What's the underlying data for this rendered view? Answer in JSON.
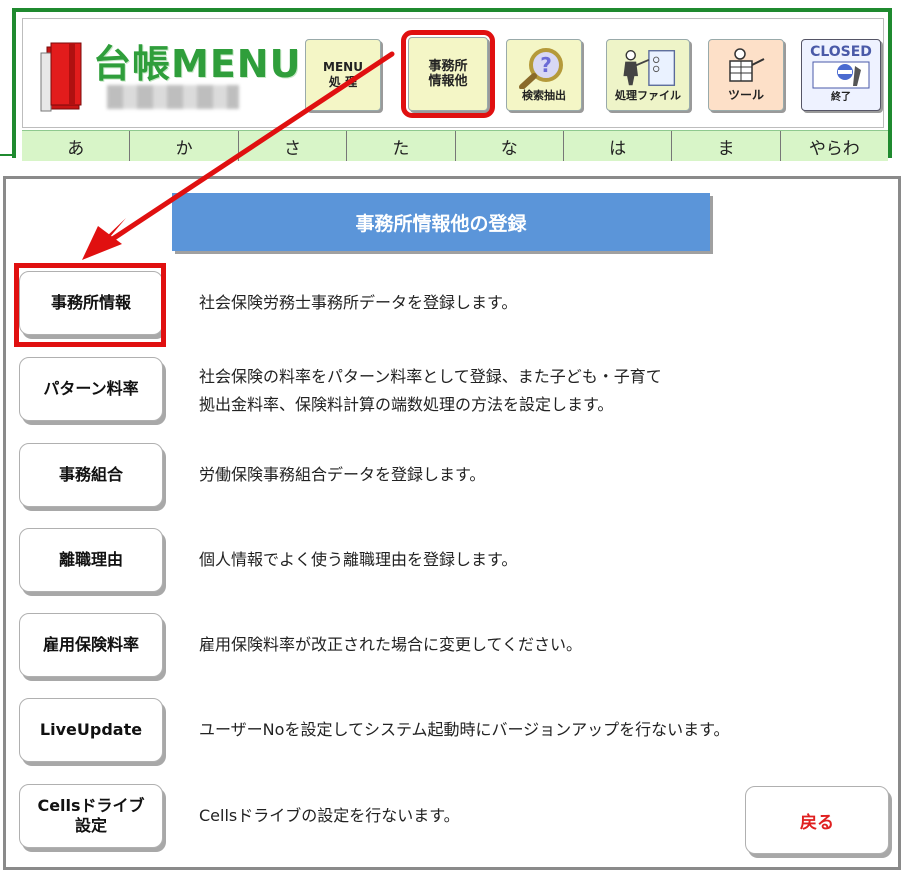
{
  "header": {
    "logo_text": "台帳MENU",
    "buttons": {
      "menu": "MENU\n処 理",
      "office": "事務所\n情報他",
      "search": "検索抽出",
      "files": "処理ファイル",
      "tools": "ツール",
      "close_top": "CLOSED",
      "close_bottom": "終了"
    },
    "kana": [
      "あ",
      "か",
      "さ",
      "た",
      "な",
      "は",
      "ま",
      "やらわ"
    ]
  },
  "panel": {
    "title": "事務所情報他の登録",
    "items": [
      {
        "label": "事務所情報",
        "desc": [
          "社会保険労務士事務所データを登録します。"
        ]
      },
      {
        "label": "パターン料率",
        "desc": [
          "社会保険の料率をパターン料率として登録、また子ども・子育て",
          "拠出金料率、保険料計算の端数処理の方法を設定します。"
        ]
      },
      {
        "label": "事務組合",
        "desc": [
          "労働保険事務組合データを登録します。"
        ]
      },
      {
        "label": "離職理由",
        "desc": [
          "個人情報でよく使う離職理由を登録します。"
        ]
      },
      {
        "label": "雇用保険料率",
        "desc": [
          "雇用保険料率が改正された場合に変更してください。"
        ]
      },
      {
        "label": "LiveUpdate",
        "desc": [
          "ユーザーNoを設定してシステム起動時にバージョンアップを行ないます。"
        ]
      },
      {
        "label": "Cellsドライブ\n設定",
        "desc": [
          "Cellsドライブの設定を行ないます。"
        ]
      }
    ],
    "back_label": "戻る"
  },
  "colors": {
    "header_border": "#1f8a2f",
    "logo_green": "#2f9e3b",
    "kana_bg": "#d8f5c8",
    "title_bg": "#5b95d9",
    "highlight_red": "#e01010",
    "back_text": "#e02020"
  },
  "icons": {
    "logo": "red-binder-icon",
    "search": "magnifier-question-icon",
    "files": "file-worker-icon",
    "tools": "worker-tool-icon",
    "close": "closed-exit-icon"
  }
}
